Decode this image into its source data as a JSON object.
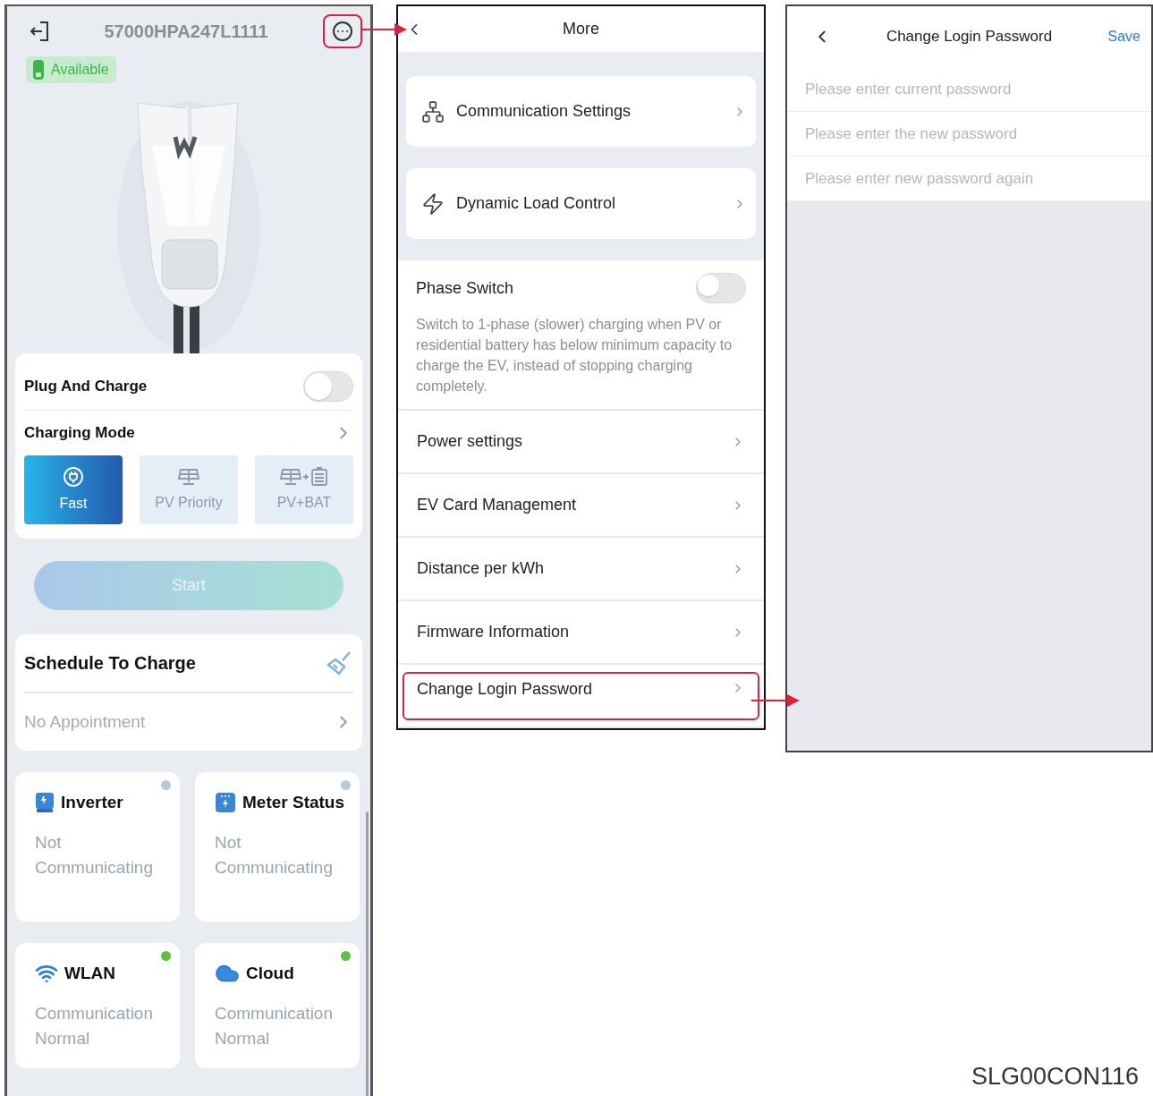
{
  "home": {
    "device_serial": "57000HPA247L1111",
    "menu_highlighted": true,
    "status": "Available",
    "plug_and_charge": {
      "label": "Plug And Charge",
      "on": false
    },
    "charging_mode": {
      "label": "Charging Mode",
      "modes": [
        {
          "label": "Fast",
          "kind": "fast",
          "selected": true
        },
        {
          "label": "PV Priority",
          "kind": "pv",
          "selected": false
        },
        {
          "label": "PV+BAT",
          "kind": "pvbat",
          "selected": false
        }
      ]
    },
    "start_button": {
      "label": "Start",
      "disabled": true
    },
    "schedule": {
      "title": "Schedule To Charge",
      "value": "No Appointment"
    },
    "devices": [
      {
        "name": "Inverter",
        "kind": "inverter",
        "status": "Not Communicating",
        "color": "#b9c8da"
      },
      {
        "name": "Meter Status",
        "kind": "meter",
        "status": "Not Communicating",
        "color": "#b9c8da"
      },
      {
        "name": "WLAN",
        "kind": "wifi",
        "status": "Communication Normal",
        "color": "#5dc145"
      },
      {
        "name": "Cloud",
        "kind": "cloud",
        "status": "Communication Normal",
        "color": "#5dc145"
      }
    ]
  },
  "more": {
    "title": "More",
    "cards": [
      {
        "label": "Communication Settings",
        "kind": "network"
      },
      {
        "label": "Dynamic Load Control",
        "kind": "bolt"
      }
    ],
    "phase_switch": {
      "label": "Phase Switch",
      "on": false,
      "description": "Switch to 1-phase (slower) charging when PV or residential battery has below minimum capacity to charge the EV, instead of stopping charging completely."
    },
    "items": [
      {
        "label": "Power settings",
        "highlighted": false
      },
      {
        "label": "EV Card Management",
        "highlighted": false
      },
      {
        "label": "Distance per kWh",
        "highlighted": false
      },
      {
        "label": "Firmware Information",
        "highlighted": false
      },
      {
        "label": "Change Login Password",
        "highlighted": true
      }
    ]
  },
  "password": {
    "title": "Change Login Password",
    "save": "Save",
    "fields": [
      {
        "placeholder": "Please enter current password"
      },
      {
        "placeholder": "Please enter the new password"
      },
      {
        "placeholder": "Please enter new password again"
      }
    ]
  },
  "caption": "SLG00CON116"
}
